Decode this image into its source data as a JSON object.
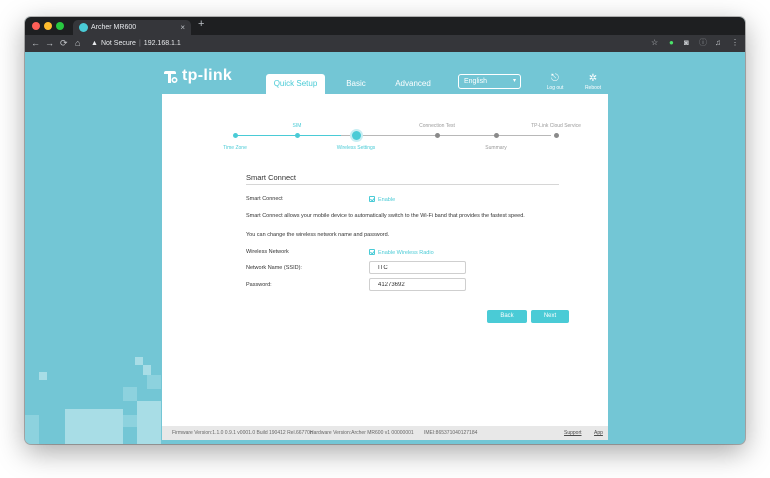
{
  "browser": {
    "tab_title": "Archer MR600",
    "tab_close": "×",
    "new_tab": "+",
    "security_label": "Not Secure",
    "url": "192.168.1.1"
  },
  "header": {
    "logo_text": "tp-link",
    "tabs": [
      {
        "label": "Quick Setup",
        "active": true
      },
      {
        "label": "Basic",
        "active": false
      },
      {
        "label": "Advanced",
        "active": false
      }
    ],
    "language": "English",
    "logout_label": "Log out",
    "reboot_label": "Reboot"
  },
  "steps": [
    {
      "label": "Time Zone",
      "state": "done",
      "label_pos": "bottom"
    },
    {
      "label": "SIM",
      "state": "done",
      "label_pos": "top"
    },
    {
      "label": "Wireless Settings",
      "state": "current",
      "label_pos": "bottom"
    },
    {
      "label": "Connection Test",
      "state": "todo",
      "label_pos": "top"
    },
    {
      "label": "Summary",
      "state": "todo",
      "label_pos": "bottom"
    },
    {
      "label": "TP-Link Cloud Service",
      "state": "todo",
      "label_pos": "top"
    }
  ],
  "section": {
    "title": "Smart Connect",
    "smart_connect_label": "Smart Connect",
    "smart_connect_checkbox": "Enable",
    "description": "Smart Connect allows your mobile device to automatically switch to the Wi-Fi band that provides the fastest speed.",
    "change_note": "You can change the wireless network name and password.",
    "wireless_network_label": "Wireless Network",
    "wireless_radio_checkbox": "Enable Wireless Radio",
    "ssid_label": "Network Name (SSID):",
    "ssid_value": "ITC",
    "password_label": "Password:",
    "password_value": "41273692"
  },
  "buttons": {
    "back": "Back",
    "next": "Next"
  },
  "footer": {
    "firmware": "Firmware Version:1.1.0 0.9.1 v0001.0 Build 190412 Rel.66770n",
    "hardware": "Hardware Version:Archer MR600 v1 00000001",
    "imei": "IMEI:865371040127184",
    "support": "Support",
    "app": "App"
  },
  "colors": {
    "accent": "#4acbd6",
    "background": "#73c6d5"
  }
}
